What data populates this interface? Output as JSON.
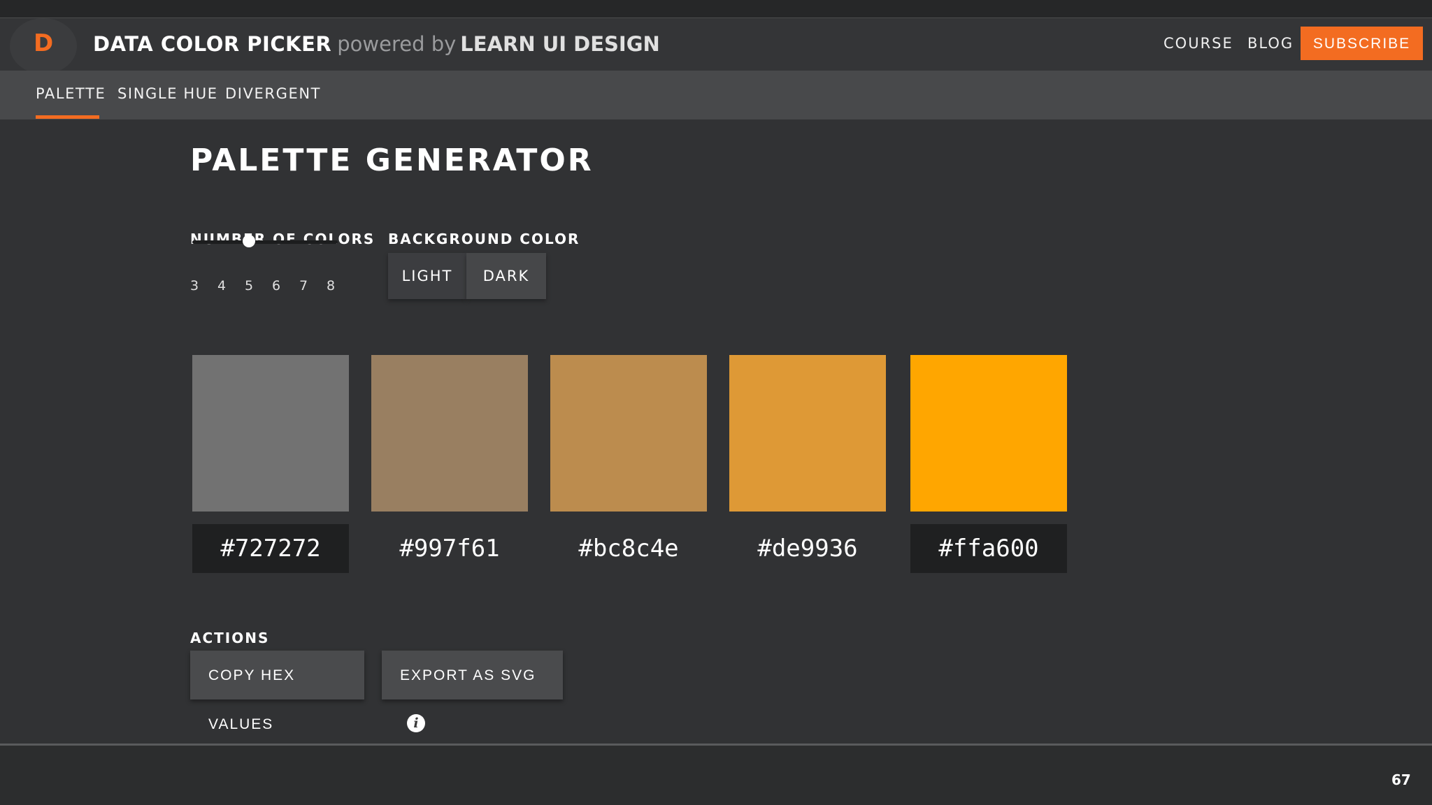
{
  "header": {
    "logo_letter": "D",
    "title": "DATA COLOR PICKER",
    "powered_by": "powered by",
    "brand": "LEARN UI DESIGN",
    "links": {
      "course": "COURSE",
      "blog": "BLOG"
    },
    "subscribe": "SUBSCRIBE"
  },
  "tabs": [
    {
      "label": "PALETTE",
      "active": true
    },
    {
      "label": "SINGLE HUE",
      "active": false
    },
    {
      "label": "DIVERGENT",
      "active": false
    }
  ],
  "main": {
    "title": "PALETTE GENERATOR",
    "number_of_colors": {
      "label": "NUMBER OF COLORS",
      "ticks": [
        "3",
        "4",
        "5",
        "6",
        "7",
        "8"
      ],
      "value": 5
    },
    "background_color": {
      "label": "BACKGROUND COLOR",
      "options": [
        "LIGHT",
        "DARK"
      ],
      "selected": "LIGHT"
    },
    "swatches": [
      {
        "hex": "#727272",
        "color": "#727272"
      },
      {
        "hex": "#997f61",
        "color": "#997f61"
      },
      {
        "hex": "#bc8c4e",
        "color": "#bc8c4e"
      },
      {
        "hex": "#de9936",
        "color": "#de9936"
      },
      {
        "hex": "#ffa600",
        "color": "#ffa600"
      }
    ],
    "actions": {
      "label": "ACTIONS",
      "copy": "COPY HEX VALUES",
      "export": "EXPORT AS SVG",
      "info_glyph": "i"
    }
  },
  "page_number": "67",
  "colors": {
    "accent": "#f36c21",
    "background": "#313234"
  }
}
